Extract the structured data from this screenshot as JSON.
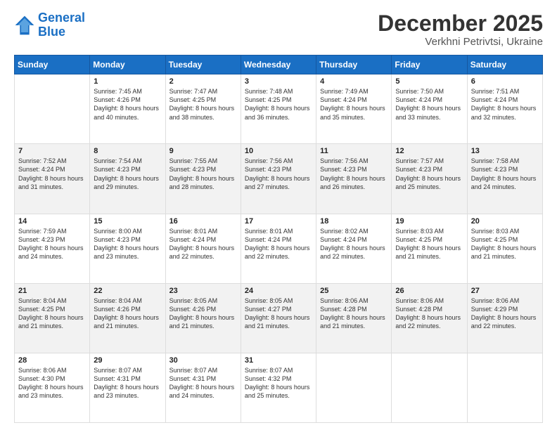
{
  "logo": {
    "line1": "General",
    "line2": "Blue"
  },
  "title": "December 2025",
  "subtitle": "Verkhni Petrivtsi, Ukraine",
  "weekdays": [
    "Sunday",
    "Monday",
    "Tuesday",
    "Wednesday",
    "Thursday",
    "Friday",
    "Saturday"
  ],
  "weeks": [
    [
      {
        "day": "",
        "sunrise": "",
        "sunset": "",
        "daylight": ""
      },
      {
        "day": "1",
        "sunrise": "Sunrise: 7:45 AM",
        "sunset": "Sunset: 4:26 PM",
        "daylight": "Daylight: 8 hours and 40 minutes."
      },
      {
        "day": "2",
        "sunrise": "Sunrise: 7:47 AM",
        "sunset": "Sunset: 4:25 PM",
        "daylight": "Daylight: 8 hours and 38 minutes."
      },
      {
        "day": "3",
        "sunrise": "Sunrise: 7:48 AM",
        "sunset": "Sunset: 4:25 PM",
        "daylight": "Daylight: 8 hours and 36 minutes."
      },
      {
        "day": "4",
        "sunrise": "Sunrise: 7:49 AM",
        "sunset": "Sunset: 4:24 PM",
        "daylight": "Daylight: 8 hours and 35 minutes."
      },
      {
        "day": "5",
        "sunrise": "Sunrise: 7:50 AM",
        "sunset": "Sunset: 4:24 PM",
        "daylight": "Daylight: 8 hours and 33 minutes."
      },
      {
        "day": "6",
        "sunrise": "Sunrise: 7:51 AM",
        "sunset": "Sunset: 4:24 PM",
        "daylight": "Daylight: 8 hours and 32 minutes."
      }
    ],
    [
      {
        "day": "7",
        "sunrise": "Sunrise: 7:52 AM",
        "sunset": "Sunset: 4:24 PM",
        "daylight": "Daylight: 8 hours and 31 minutes."
      },
      {
        "day": "8",
        "sunrise": "Sunrise: 7:54 AM",
        "sunset": "Sunset: 4:23 PM",
        "daylight": "Daylight: 8 hours and 29 minutes."
      },
      {
        "day": "9",
        "sunrise": "Sunrise: 7:55 AM",
        "sunset": "Sunset: 4:23 PM",
        "daylight": "Daylight: 8 hours and 28 minutes."
      },
      {
        "day": "10",
        "sunrise": "Sunrise: 7:56 AM",
        "sunset": "Sunset: 4:23 PM",
        "daylight": "Daylight: 8 hours and 27 minutes."
      },
      {
        "day": "11",
        "sunrise": "Sunrise: 7:56 AM",
        "sunset": "Sunset: 4:23 PM",
        "daylight": "Daylight: 8 hours and 26 minutes."
      },
      {
        "day": "12",
        "sunrise": "Sunrise: 7:57 AM",
        "sunset": "Sunset: 4:23 PM",
        "daylight": "Daylight: 8 hours and 25 minutes."
      },
      {
        "day": "13",
        "sunrise": "Sunrise: 7:58 AM",
        "sunset": "Sunset: 4:23 PM",
        "daylight": "Daylight: 8 hours and 24 minutes."
      }
    ],
    [
      {
        "day": "14",
        "sunrise": "Sunrise: 7:59 AM",
        "sunset": "Sunset: 4:23 PM",
        "daylight": "Daylight: 8 hours and 24 minutes."
      },
      {
        "day": "15",
        "sunrise": "Sunrise: 8:00 AM",
        "sunset": "Sunset: 4:23 PM",
        "daylight": "Daylight: 8 hours and 23 minutes."
      },
      {
        "day": "16",
        "sunrise": "Sunrise: 8:01 AM",
        "sunset": "Sunset: 4:24 PM",
        "daylight": "Daylight: 8 hours and 22 minutes."
      },
      {
        "day": "17",
        "sunrise": "Sunrise: 8:01 AM",
        "sunset": "Sunset: 4:24 PM",
        "daylight": "Daylight: 8 hours and 22 minutes."
      },
      {
        "day": "18",
        "sunrise": "Sunrise: 8:02 AM",
        "sunset": "Sunset: 4:24 PM",
        "daylight": "Daylight: 8 hours and 22 minutes."
      },
      {
        "day": "19",
        "sunrise": "Sunrise: 8:03 AM",
        "sunset": "Sunset: 4:25 PM",
        "daylight": "Daylight: 8 hours and 21 minutes."
      },
      {
        "day": "20",
        "sunrise": "Sunrise: 8:03 AM",
        "sunset": "Sunset: 4:25 PM",
        "daylight": "Daylight: 8 hours and 21 minutes."
      }
    ],
    [
      {
        "day": "21",
        "sunrise": "Sunrise: 8:04 AM",
        "sunset": "Sunset: 4:25 PM",
        "daylight": "Daylight: 8 hours and 21 minutes."
      },
      {
        "day": "22",
        "sunrise": "Sunrise: 8:04 AM",
        "sunset": "Sunset: 4:26 PM",
        "daylight": "Daylight: 8 hours and 21 minutes."
      },
      {
        "day": "23",
        "sunrise": "Sunrise: 8:05 AM",
        "sunset": "Sunset: 4:26 PM",
        "daylight": "Daylight: 8 hours and 21 minutes."
      },
      {
        "day": "24",
        "sunrise": "Sunrise: 8:05 AM",
        "sunset": "Sunset: 4:27 PM",
        "daylight": "Daylight: 8 hours and 21 minutes."
      },
      {
        "day": "25",
        "sunrise": "Sunrise: 8:06 AM",
        "sunset": "Sunset: 4:28 PM",
        "daylight": "Daylight: 8 hours and 21 minutes."
      },
      {
        "day": "26",
        "sunrise": "Sunrise: 8:06 AM",
        "sunset": "Sunset: 4:28 PM",
        "daylight": "Daylight: 8 hours and 22 minutes."
      },
      {
        "day": "27",
        "sunrise": "Sunrise: 8:06 AM",
        "sunset": "Sunset: 4:29 PM",
        "daylight": "Daylight: 8 hours and 22 minutes."
      }
    ],
    [
      {
        "day": "28",
        "sunrise": "Sunrise: 8:06 AM",
        "sunset": "Sunset: 4:30 PM",
        "daylight": "Daylight: 8 hours and 23 minutes."
      },
      {
        "day": "29",
        "sunrise": "Sunrise: 8:07 AM",
        "sunset": "Sunset: 4:31 PM",
        "daylight": "Daylight: 8 hours and 23 minutes."
      },
      {
        "day": "30",
        "sunrise": "Sunrise: 8:07 AM",
        "sunset": "Sunset: 4:31 PM",
        "daylight": "Daylight: 8 hours and 24 minutes."
      },
      {
        "day": "31",
        "sunrise": "Sunrise: 8:07 AM",
        "sunset": "Sunset: 4:32 PM",
        "daylight": "Daylight: 8 hours and 25 minutes."
      },
      {
        "day": "",
        "sunrise": "",
        "sunset": "",
        "daylight": ""
      },
      {
        "day": "",
        "sunrise": "",
        "sunset": "",
        "daylight": ""
      },
      {
        "day": "",
        "sunrise": "",
        "sunset": "",
        "daylight": ""
      }
    ]
  ]
}
